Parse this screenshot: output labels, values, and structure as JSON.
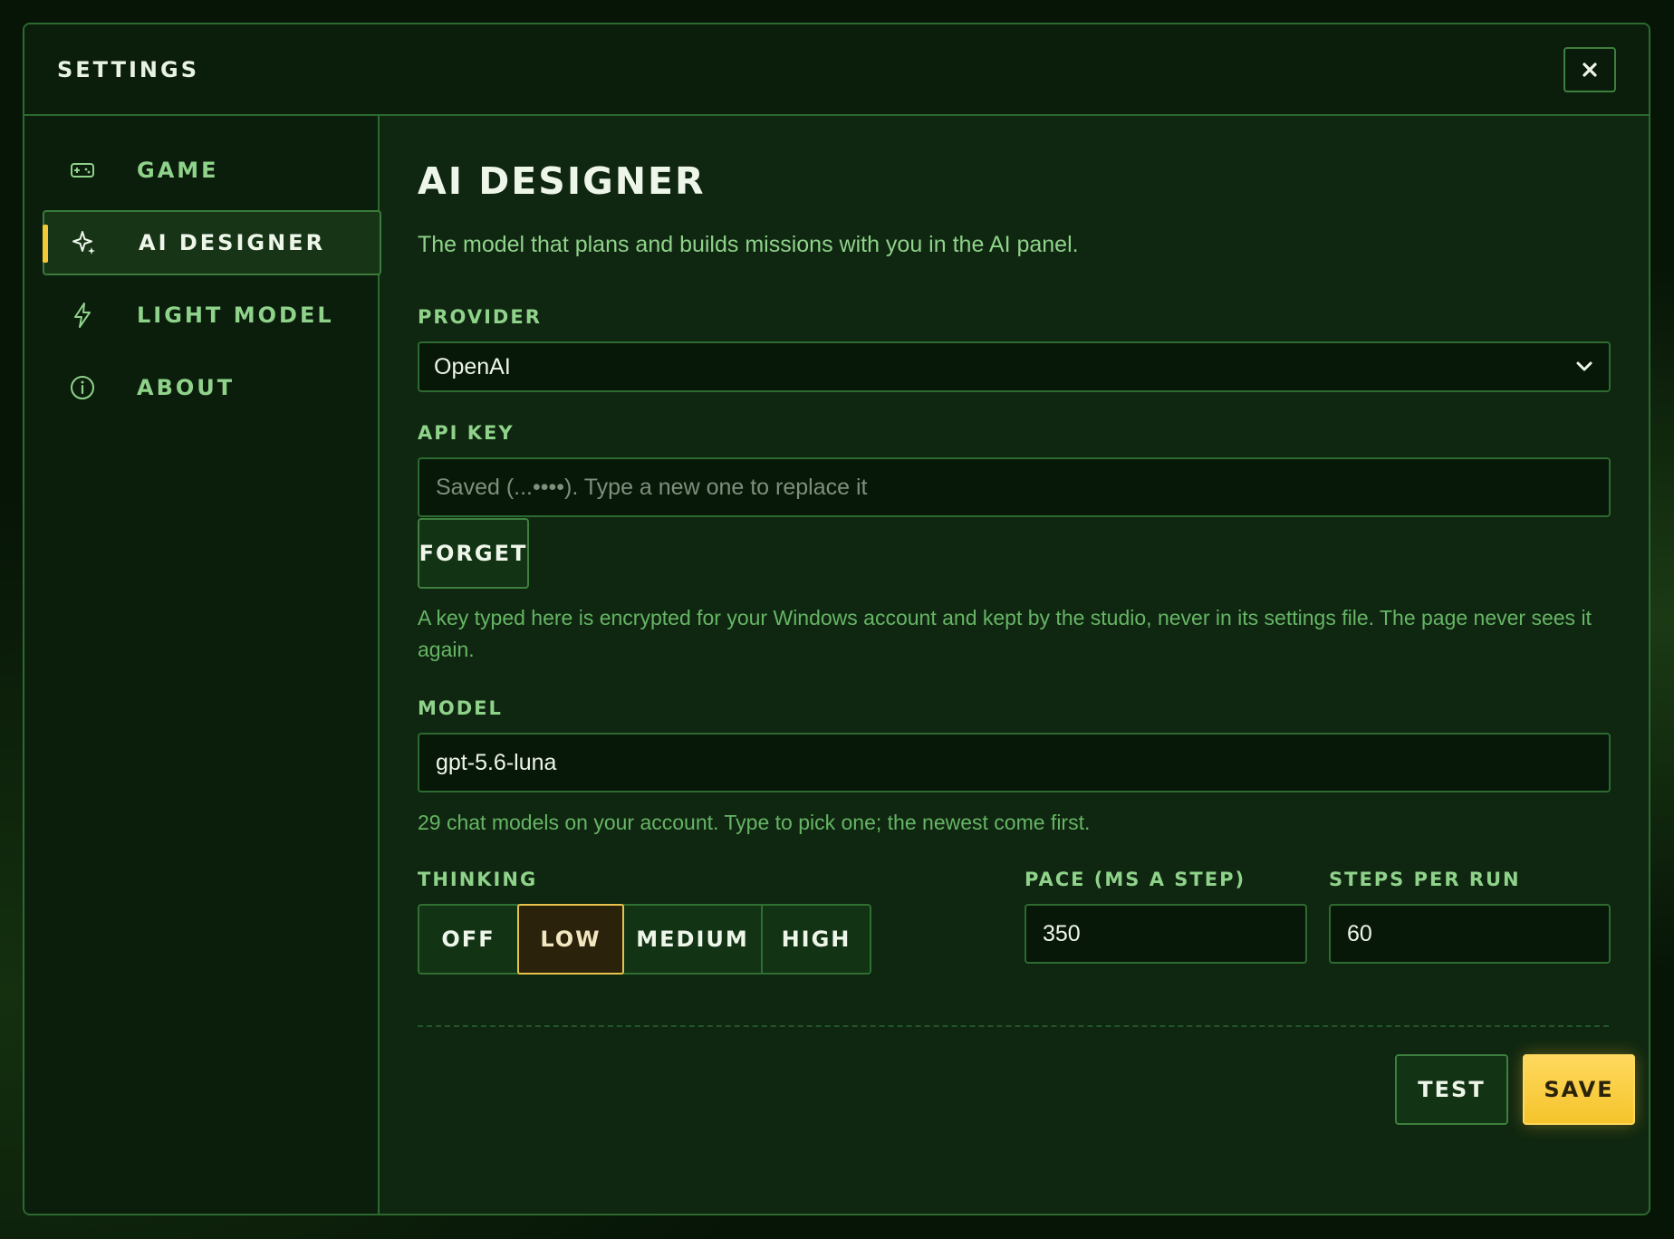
{
  "window": {
    "title": "SETTINGS",
    "close_icon": "close-icon"
  },
  "sidebar": {
    "items": [
      {
        "label": "GAME",
        "icon": "gamepad-icon",
        "active": false
      },
      {
        "label": "AI DESIGNER",
        "icon": "sparkle-icon",
        "active": true
      },
      {
        "label": "LIGHT MODEL",
        "icon": "lightning-icon",
        "active": false
      },
      {
        "label": "ABOUT",
        "icon": "info-icon",
        "active": false
      }
    ]
  },
  "main": {
    "title": "AI DESIGNER",
    "description": "The model that plans and builds missions with you in the AI panel.",
    "provider": {
      "label": "PROVIDER",
      "value": "OpenAI"
    },
    "api_key": {
      "label": "API KEY",
      "value": "",
      "placeholder": "Saved (...••••). Type a new one to replace it",
      "forget_label": "FORGET",
      "help": "A key typed here is encrypted for your Windows account and kept by the studio, never in its settings file. The page never sees it again."
    },
    "model": {
      "label": "MODEL",
      "value": "gpt-5.6-luna",
      "help": "29 chat models on your account. Type to pick one; the newest come first."
    },
    "thinking": {
      "label": "THINKING",
      "options": [
        "OFF",
        "LOW",
        "MEDIUM",
        "HIGH"
      ],
      "selected": "LOW"
    },
    "pace": {
      "label": "PACE (MS A STEP)",
      "value": "350"
    },
    "steps": {
      "label": "STEPS PER RUN",
      "value": "60"
    },
    "actions": {
      "test_label": "TEST",
      "save_label": "SAVE"
    }
  },
  "colors": {
    "accent": "#f5c42c",
    "text_green": "#8fd28a",
    "border": "#2c6a30",
    "background": "#0f2610"
  }
}
